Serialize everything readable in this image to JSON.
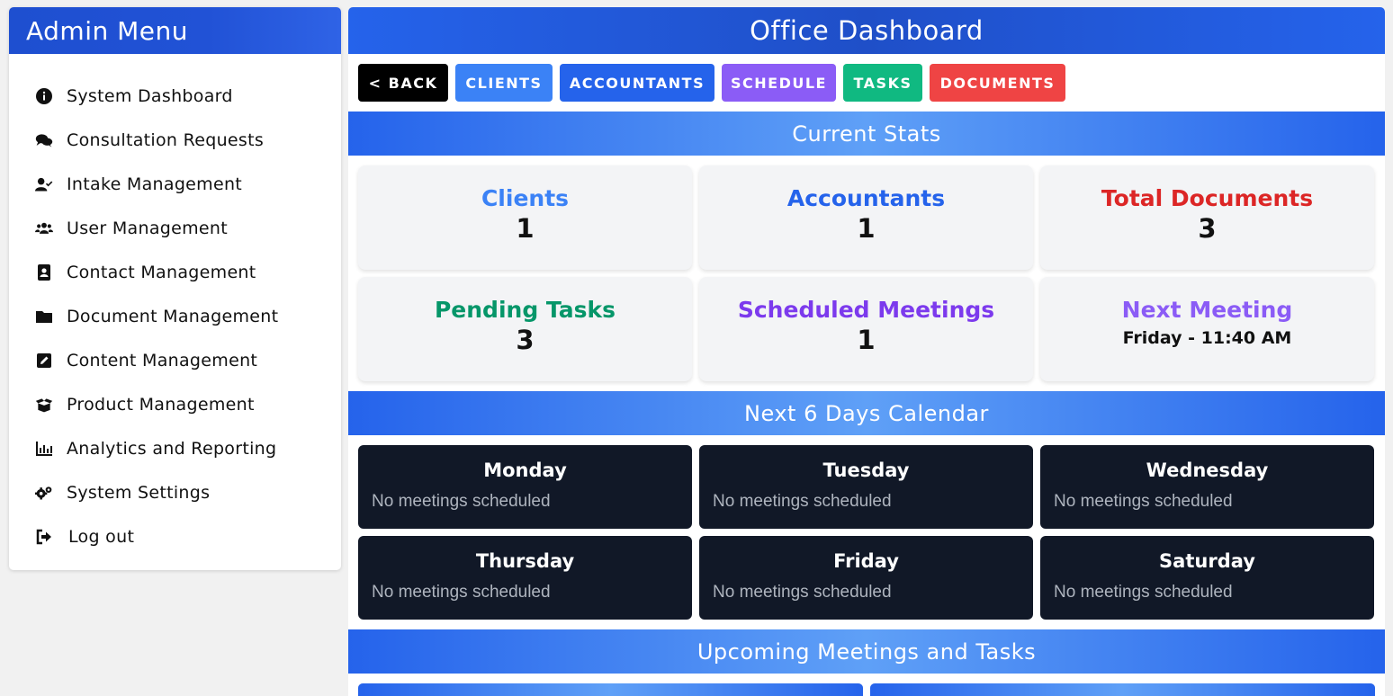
{
  "sidebar": {
    "title": "Admin Menu",
    "items": [
      {
        "label": "System Dashboard",
        "icon": "info-circle-icon"
      },
      {
        "label": "Consultation Requests",
        "icon": "comments-icon"
      },
      {
        "label": "Intake Management",
        "icon": "user-check-icon"
      },
      {
        "label": "User Management",
        "icon": "users-icon"
      },
      {
        "label": "Contact Management",
        "icon": "address-book-icon"
      },
      {
        "label": "Document Management",
        "icon": "folder-icon"
      },
      {
        "label": "Content Management",
        "icon": "edit-icon"
      },
      {
        "label": "Product Management",
        "icon": "box-open-icon"
      },
      {
        "label": "Analytics and Reporting",
        "icon": "chart-bar-icon"
      },
      {
        "label": "System Settings",
        "icon": "cogs-icon"
      },
      {
        "label": "Log out",
        "icon": "sign-out-icon"
      }
    ]
  },
  "header": {
    "title": "Office Dashboard"
  },
  "toolbar": {
    "back": "< BACK",
    "clients": "CLIENTS",
    "accountants": "ACCOUNTANTS",
    "schedule": "SCHEDULE",
    "tasks": "TASKS",
    "documents": "DOCUMENTS"
  },
  "colors": {
    "back": "#000000",
    "clients": "#3b82f6",
    "accountants": "#2563eb",
    "schedule": "#8b5cf6",
    "tasks": "#10b981",
    "documents": "#ef4444"
  },
  "sections": {
    "stats": "Current Stats",
    "calendar": "Next 6 Days Calendar",
    "upcoming": "Upcoming Meetings and Tasks"
  },
  "stats": [
    {
      "title": "Clients",
      "value": "1",
      "color": "#3b82f6"
    },
    {
      "title": "Accountants",
      "value": "1",
      "color": "#2563eb"
    },
    {
      "title": "Total Documents",
      "value": "3",
      "color": "#dc2626"
    },
    {
      "title": "Pending Tasks",
      "value": "3",
      "color": "#059669"
    },
    {
      "title": "Scheduled Meetings",
      "value": "1",
      "color": "#7c3aed"
    },
    {
      "title": "Next Meeting",
      "value": "Friday - 11:40 AM",
      "color": "#8b5cf6"
    }
  ],
  "calendar": [
    {
      "day": "Monday",
      "note": "No meetings scheduled"
    },
    {
      "day": "Tuesday",
      "note": "No meetings scheduled"
    },
    {
      "day": "Wednesday",
      "note": "No meetings scheduled"
    },
    {
      "day": "Thursday",
      "note": "No meetings scheduled"
    },
    {
      "day": "Friday",
      "note": "No meetings scheduled"
    },
    {
      "day": "Saturday",
      "note": "No meetings scheduled"
    }
  ]
}
